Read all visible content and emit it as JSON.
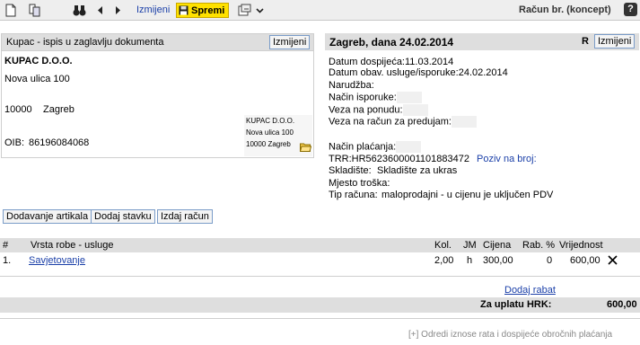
{
  "toolbar": {
    "edit_label": "Izmijeni",
    "save_label": "Spremi",
    "document_title": "Račun br. (koncept)",
    "help_label": "?"
  },
  "customer": {
    "panel_title": "Kupac - ispis u zaglavlju dokumenta",
    "edit_label": "Izmijeni",
    "name": "KUPAC D.O.O.",
    "street": "Nova ulica 100",
    "postal_code": "10000",
    "city": "Zagreb",
    "oib_label": "OIB:",
    "oib": "86196084068",
    "card": {
      "line1": "KUPAC D.O.O.",
      "line2": "Nova ulica 100",
      "line3": "10000 Zagreb"
    }
  },
  "document": {
    "title": "Zagreb, dana 24.02.2014",
    "r_label": "R",
    "edit_label": "Izmijeni",
    "due_date": "Datum dospijeća:11.03.2014",
    "service_date": "Datum obav. usluge/isporuke:24.02.2014",
    "order": "Narudžba:",
    "delivery_method": "Način isporuke:",
    "offer_link": "Veza na ponudu:",
    "advance_link": "Veza na račun za predujam:",
    "payment_method": "Način plaćanja:",
    "trr": "TRR:HR5623600001101883472",
    "reference": "Poziv na broj:",
    "warehouse_label": "Skladište:",
    "warehouse": "Skladište za ukras",
    "cost_center": "Mjesto troška:",
    "invoice_type_label": "Tip računa:",
    "invoice_type": "maloprodajni - u cijenu je uključen PDV"
  },
  "actions": {
    "add_items": "Dodavanje artikala",
    "add_row": "Dodaj stavku",
    "issue": "Izdaj račun"
  },
  "table": {
    "headers": {
      "num": "#",
      "item": "Vrsta robe - usluge",
      "qty": "Kol.",
      "unit": "JM",
      "price": "Cijena",
      "discount": "Rab. %",
      "value": "Vrijednost"
    },
    "rows": [
      {
        "num": "1.",
        "item": "Savjetovanje",
        "qty": "2,00",
        "unit": "h",
        "price": "300,00",
        "discount": "0",
        "value": "600,00"
      }
    ]
  },
  "totals": {
    "add_discount": "Dodaj rabat",
    "total_label": "Za uplatu HRK:",
    "total_value": "600,00"
  },
  "footer": {
    "installments": "[+] Odredi iznose rata i dospijeće obročnih plaćanja"
  },
  "colors": {
    "accent_link": "#1a3fa8",
    "save_button": "#ffe100",
    "header_bar": "#dedede"
  }
}
